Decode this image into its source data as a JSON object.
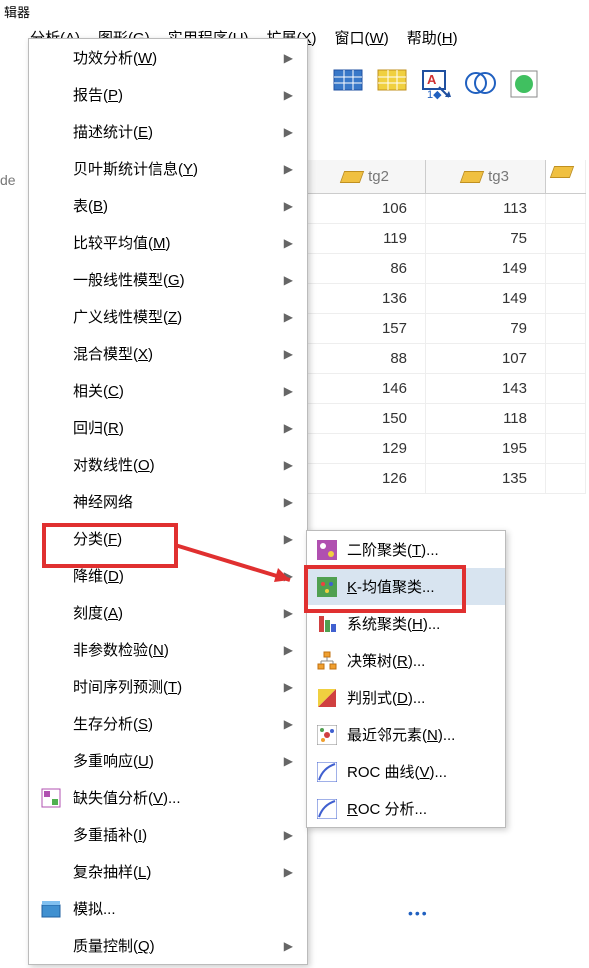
{
  "window_title": "辑器",
  "menubar": {
    "analyze": "分析(A)",
    "graph": "图形(G)",
    "utility": "实用程序(U)",
    "extension": "扩展(X)",
    "window": "窗口(W)",
    "help": "帮助(H)"
  },
  "header_left": "de",
  "columns": {
    "tg2": "tg2",
    "tg3": "tg3"
  },
  "rows": [
    {
      "tg2": "106",
      "tg3": "113"
    },
    {
      "tg2": "119",
      "tg3": "75"
    },
    {
      "tg2": "86",
      "tg3": "149"
    },
    {
      "tg2": "136",
      "tg3": "149"
    },
    {
      "tg2": "157",
      "tg3": "79"
    },
    {
      "tg2": "88",
      "tg3": "107"
    },
    {
      "tg2": "146",
      "tg3": "143"
    },
    {
      "tg2": "150",
      "tg3": "118"
    },
    {
      "tg2": "129",
      "tg3": "195"
    },
    {
      "tg2": "126",
      "tg3": "135"
    }
  ],
  "menu": {
    "power": "功效分析(W)",
    "reports": "报告(P)",
    "desc": "描述统计(E)",
    "bayes": "贝叶斯统计信息(Y)",
    "tables": "表(B)",
    "compare": "比较平均值(M)",
    "glm": "一般线性模型(G)",
    "gzlm": "广义线性模型(Z)",
    "mixed": "混合模型(X)",
    "corr": "相关(C)",
    "regr": "回归(R)",
    "loglin": "对数线性(O)",
    "neural": "神经网络",
    "classify": "分类(F)",
    "dimred": "降维(D)",
    "scale": "刻度(A)",
    "nonpar": "非参数检验(N)",
    "ts": "时间序列预测(T)",
    "surv": "生存分析(S)",
    "multresp": "多重响应(U)",
    "missing": "缺失值分析(V)...",
    "impute": "多重插补(I)",
    "complex": "复杂抽样(L)",
    "simulate": "模拟...",
    "quality": "质量控制(Q)"
  },
  "submenu": {
    "twostep": "二阶聚类(T)...",
    "kmeans": "K-均值聚类...",
    "hier": "系统聚类(H)...",
    "tree": "决策树(R)...",
    "discrim": "判别式(D)...",
    "knn": "最近邻元素(N)...",
    "rocv": "ROC 曲线(V)...",
    "roc": "ROC 分析..."
  },
  "more": "•••"
}
